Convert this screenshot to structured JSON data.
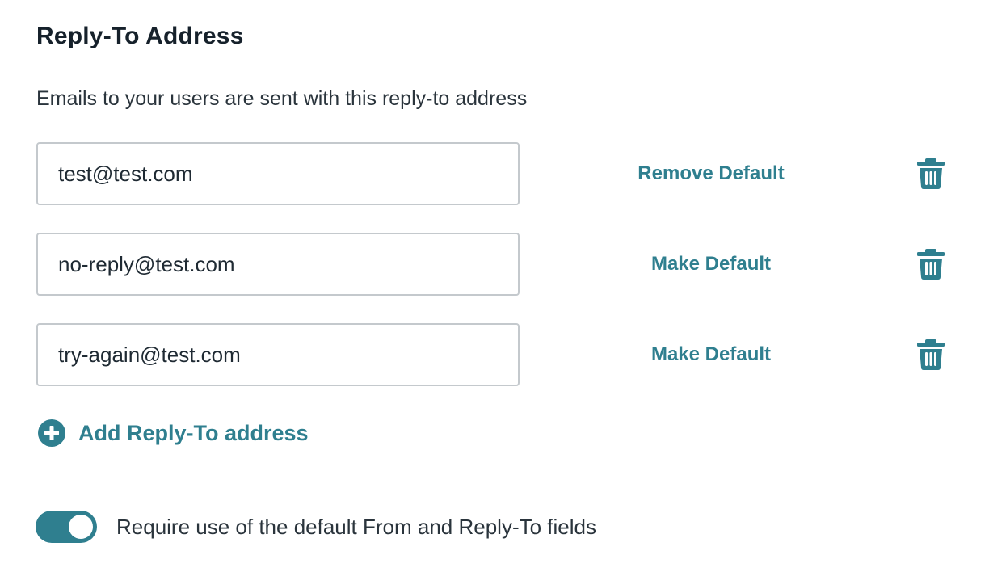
{
  "section": {
    "title": "Reply-To Address",
    "description": "Emails to your users are sent with this reply-to address"
  },
  "addresses": [
    {
      "email": "test@test.com",
      "action_label": "Remove Default",
      "is_default": true,
      "delete_icon": "trash-icon"
    },
    {
      "email": "no-reply@test.com",
      "action_label": "Make Default",
      "is_default": false,
      "delete_icon": "trash-icon"
    },
    {
      "email": "try-again@test.com",
      "action_label": "Make Default",
      "is_default": false,
      "delete_icon": "trash-icon"
    }
  ],
  "add_address": {
    "label": "Add Reply-To address",
    "icon": "plus-circle-icon"
  },
  "require_defaults": {
    "label": "Require use of the default From and Reply-To fields",
    "enabled": true
  },
  "colors": {
    "accent": "#2f7f8f",
    "title_text": "#16212b",
    "body_text": "#2a343c",
    "input_border": "#c4c9cd"
  }
}
